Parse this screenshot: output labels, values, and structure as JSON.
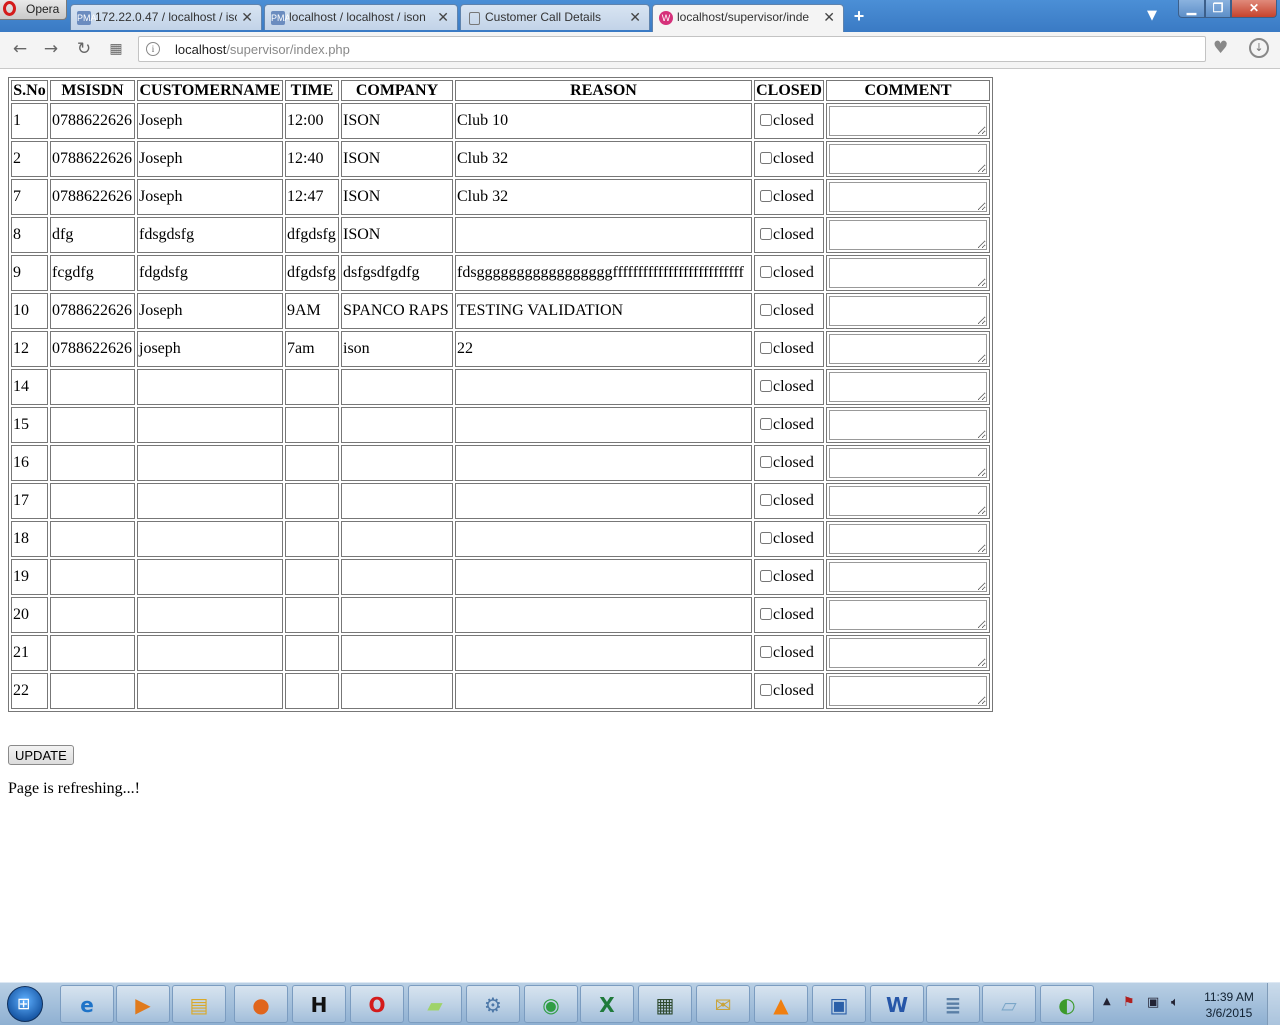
{
  "browser": {
    "menu_label": "Opera",
    "tabs": [
      {
        "title": "172.22.0.47 / localhost / isc",
        "icon": "phpmyadmin-icon",
        "icon_text": "PMA",
        "active": false
      },
      {
        "title": "localhost / localhost / ison",
        "icon": "phpmyadmin-icon",
        "icon_text": "PMA",
        "active": false
      },
      {
        "title": "Customer Call Details",
        "icon": "document-icon",
        "icon_text": "",
        "active": false
      },
      {
        "title": "localhost/supervisor/inde",
        "icon": "wamp-icon",
        "icon_text": "W",
        "active": true
      }
    ],
    "address": {
      "host": "localhost",
      "path": "/supervisor/index.php"
    }
  },
  "page": {
    "table": {
      "headers": [
        "S.No",
        "MSISDN",
        "CUSTOMERNAME",
        "TIME",
        "COMPANY",
        "REASON",
        "CLOSED",
        "COMMENT"
      ],
      "checkbox_label": "closed",
      "rows": [
        {
          "sno": "1",
          "msisdn": "0788622626",
          "name": "Joseph",
          "time": "12:00",
          "company": "ISON",
          "reason": "Club 10"
        },
        {
          "sno": "2",
          "msisdn": "0788622626",
          "name": "Joseph",
          "time": "12:40",
          "company": "ISON",
          "reason": "Club 32"
        },
        {
          "sno": "7",
          "msisdn": "0788622626",
          "name": "Joseph",
          "time": "12:47",
          "company": "ISON",
          "reason": "Club 32"
        },
        {
          "sno": "8",
          "msisdn": "dfg",
          "name": "fdsgdsfg",
          "time": "dfgdsfg",
          "company": "ISON",
          "reason": ""
        },
        {
          "sno": "9",
          "msisdn": "fcgdfg",
          "name": "fdgdsfg",
          "time": "dfgdsfg",
          "company": "dsfgsdfgdfg",
          "reason": "fdsgggggggggggggggggffffffffffffffffffffffffff"
        },
        {
          "sno": "10",
          "msisdn": "0788622626",
          "name": "Joseph",
          "time": "9AM",
          "company": "SPANCO RAPS",
          "reason": "TESTING VALIDATION"
        },
        {
          "sno": "12",
          "msisdn": "0788622626",
          "name": "joseph",
          "time": "7am",
          "company": "ison",
          "reason": "22"
        },
        {
          "sno": "14",
          "msisdn": "",
          "name": "",
          "time": "",
          "company": "",
          "reason": ""
        },
        {
          "sno": "15",
          "msisdn": "",
          "name": "",
          "time": "",
          "company": "",
          "reason": ""
        },
        {
          "sno": "16",
          "msisdn": "",
          "name": "",
          "time": "",
          "company": "",
          "reason": ""
        },
        {
          "sno": "17",
          "msisdn": "",
          "name": "",
          "time": "",
          "company": "",
          "reason": ""
        },
        {
          "sno": "18",
          "msisdn": "",
          "name": "",
          "time": "",
          "company": "",
          "reason": ""
        },
        {
          "sno": "19",
          "msisdn": "",
          "name": "",
          "time": "",
          "company": "",
          "reason": ""
        },
        {
          "sno": "20",
          "msisdn": "",
          "name": "",
          "time": "",
          "company": "",
          "reason": ""
        },
        {
          "sno": "21",
          "msisdn": "",
          "name": "",
          "time": "",
          "company": "",
          "reason": ""
        },
        {
          "sno": "22",
          "msisdn": "",
          "name": "",
          "time": "",
          "company": "",
          "reason": ""
        }
      ]
    },
    "update_label": "UPDATE",
    "status_message": "Page is refreshing...!"
  },
  "taskbar": {
    "apps": [
      {
        "name": "internet-explorer-icon",
        "glyph": "e",
        "color": "#1e73c8"
      },
      {
        "name": "media-player-icon",
        "glyph": "▶",
        "color": "#e07a1c"
      },
      {
        "name": "file-explorer-icon",
        "glyph": "▤",
        "color": "#d9a92a"
      },
      {
        "name": "firefox-icon",
        "glyph": "●",
        "color": "#e0651c"
      },
      {
        "name": "h-app-icon",
        "glyph": "H",
        "color": "#111111"
      },
      {
        "name": "opera-icon",
        "glyph": "O",
        "color": "#d41b1b"
      },
      {
        "name": "sticky-notes-icon",
        "glyph": "▰",
        "color": "#9fd36a"
      },
      {
        "name": "settings-gears-icon",
        "glyph": "⚙",
        "color": "#4d78a8"
      },
      {
        "name": "chrome-icon",
        "glyph": "◉",
        "color": "#2f9e44"
      },
      {
        "name": "excel-icon",
        "glyph": "X",
        "color": "#1f7a3a"
      },
      {
        "name": "terminal-icon",
        "glyph": "▦",
        "color": "#2e4a2e"
      },
      {
        "name": "mail-icon",
        "glyph": "✉",
        "color": "#c9a43a"
      },
      {
        "name": "vlc-icon",
        "glyph": "▲",
        "color": "#f07f10"
      },
      {
        "name": "remote-desktop-icon",
        "glyph": "▣",
        "color": "#2b5fa8"
      },
      {
        "name": "word-icon",
        "glyph": "W",
        "color": "#2656a8"
      },
      {
        "name": "database-icon",
        "glyph": "≣",
        "color": "#5a7fa6"
      },
      {
        "name": "notepad-icon",
        "glyph": "▱",
        "color": "#7aa6c8"
      },
      {
        "name": "dreamweaver-icon",
        "glyph": "◐",
        "color": "#3c9a2a"
      }
    ],
    "clock_time": "11:39 AM",
    "clock_date": "3/6/2015"
  }
}
